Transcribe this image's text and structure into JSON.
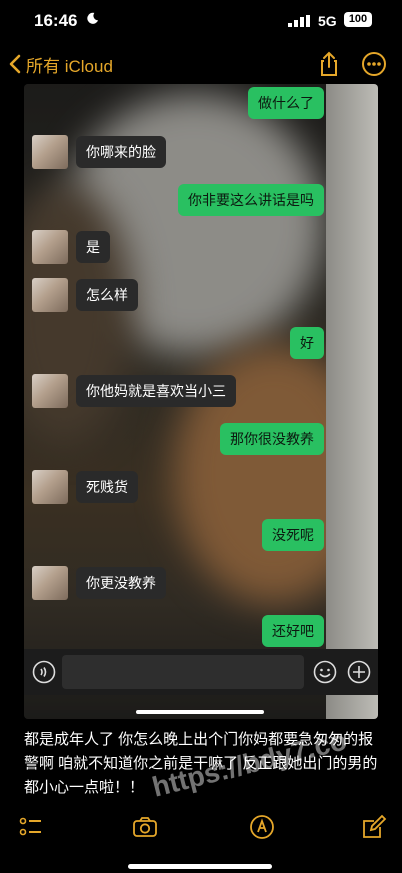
{
  "status_bar": {
    "time": "16:46",
    "network": "5G",
    "battery": "100"
  },
  "nav": {
    "back_label": "所有 iCloud"
  },
  "chat": {
    "messages": [
      {
        "side": "sent",
        "text": "做什么了"
      },
      {
        "side": "recv",
        "text": "你哪来的脸"
      },
      {
        "side": "sent",
        "text": "你非要这么讲话是吗"
      },
      {
        "side": "recv",
        "text": "是"
      },
      {
        "side": "recv",
        "text": "怎么样"
      },
      {
        "side": "sent",
        "text": "好"
      },
      {
        "side": "recv",
        "text": "你他妈就是喜欢当小三"
      },
      {
        "side": "sent",
        "text": "那你很没教养"
      },
      {
        "side": "recv",
        "text": "死贱货"
      },
      {
        "side": "sent",
        "text": "没死呢"
      },
      {
        "side": "recv",
        "text": "你更没教养"
      },
      {
        "side": "sent",
        "text": "还好吧"
      }
    ]
  },
  "note": {
    "body": "都是成年人了 你怎么晚上出个门你妈都要急匆匆的报警啊 咱就不知道你之前是干嘛了 反正跟她出门的男的都小心一点啦！！",
    "watermark": "https://bdy7.co"
  },
  "colors": {
    "accent": "#e5a72a",
    "sent_bubble": "#29c061",
    "recv_bubble": "#2a2a2a"
  }
}
